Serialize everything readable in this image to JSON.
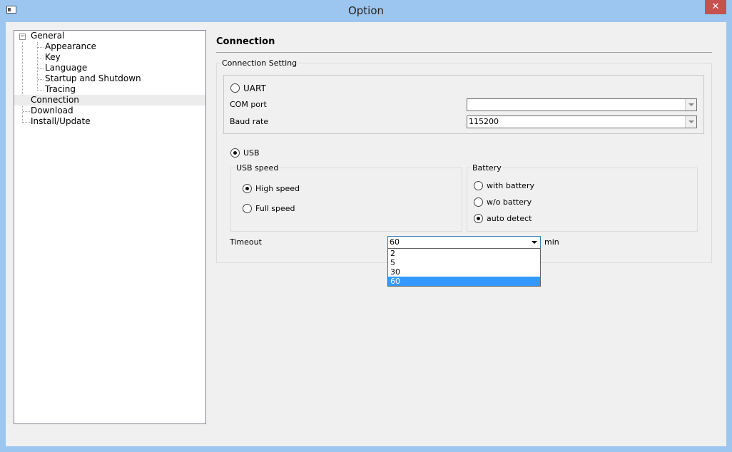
{
  "window": {
    "title": "Option",
    "close_symbol": "✕"
  },
  "tree": {
    "items": [
      {
        "label": "General",
        "expander": "−"
      },
      {
        "label": "Appearance"
      },
      {
        "label": "Key"
      },
      {
        "label": "Language"
      },
      {
        "label": "Startup and Shutdown"
      },
      {
        "label": "Tracing"
      },
      {
        "label": "Connection",
        "selected": true
      },
      {
        "label": "Download"
      },
      {
        "label": "Install/Update"
      }
    ]
  },
  "panel": {
    "title": "Connection",
    "connection_group_label": "Connection Setting",
    "uart": {
      "label": "UART",
      "checked": false,
      "com_port_label": "COM port",
      "com_port_value": "",
      "baud_rate_label": "Baud rate",
      "baud_rate_value": "115200"
    },
    "usb": {
      "label": "USB",
      "checked": true,
      "speed_group_label": "USB speed",
      "speed_options": [
        {
          "label": "High speed",
          "checked": true
        },
        {
          "label": "Full speed",
          "checked": false
        }
      ],
      "battery_group_label": "Battery",
      "battery_options": [
        {
          "label": "with battery",
          "checked": false
        },
        {
          "label": "w/o battery",
          "checked": false
        },
        {
          "label": "auto detect",
          "checked": true
        }
      ]
    },
    "timeout": {
      "label": "Timeout",
      "value": "60",
      "unit": "min",
      "options": [
        "2",
        "5",
        "30",
        "60"
      ],
      "selected_option": "60"
    }
  },
  "icons": {
    "app": "window-icon",
    "close": "close-icon",
    "combo_arrow": "chevron-down-icon",
    "tree_expander": "minus-box-icon"
  },
  "colors": {
    "title_bar": "#9cc6ef",
    "close_button": "#c75050",
    "selection": "#3399ff"
  }
}
